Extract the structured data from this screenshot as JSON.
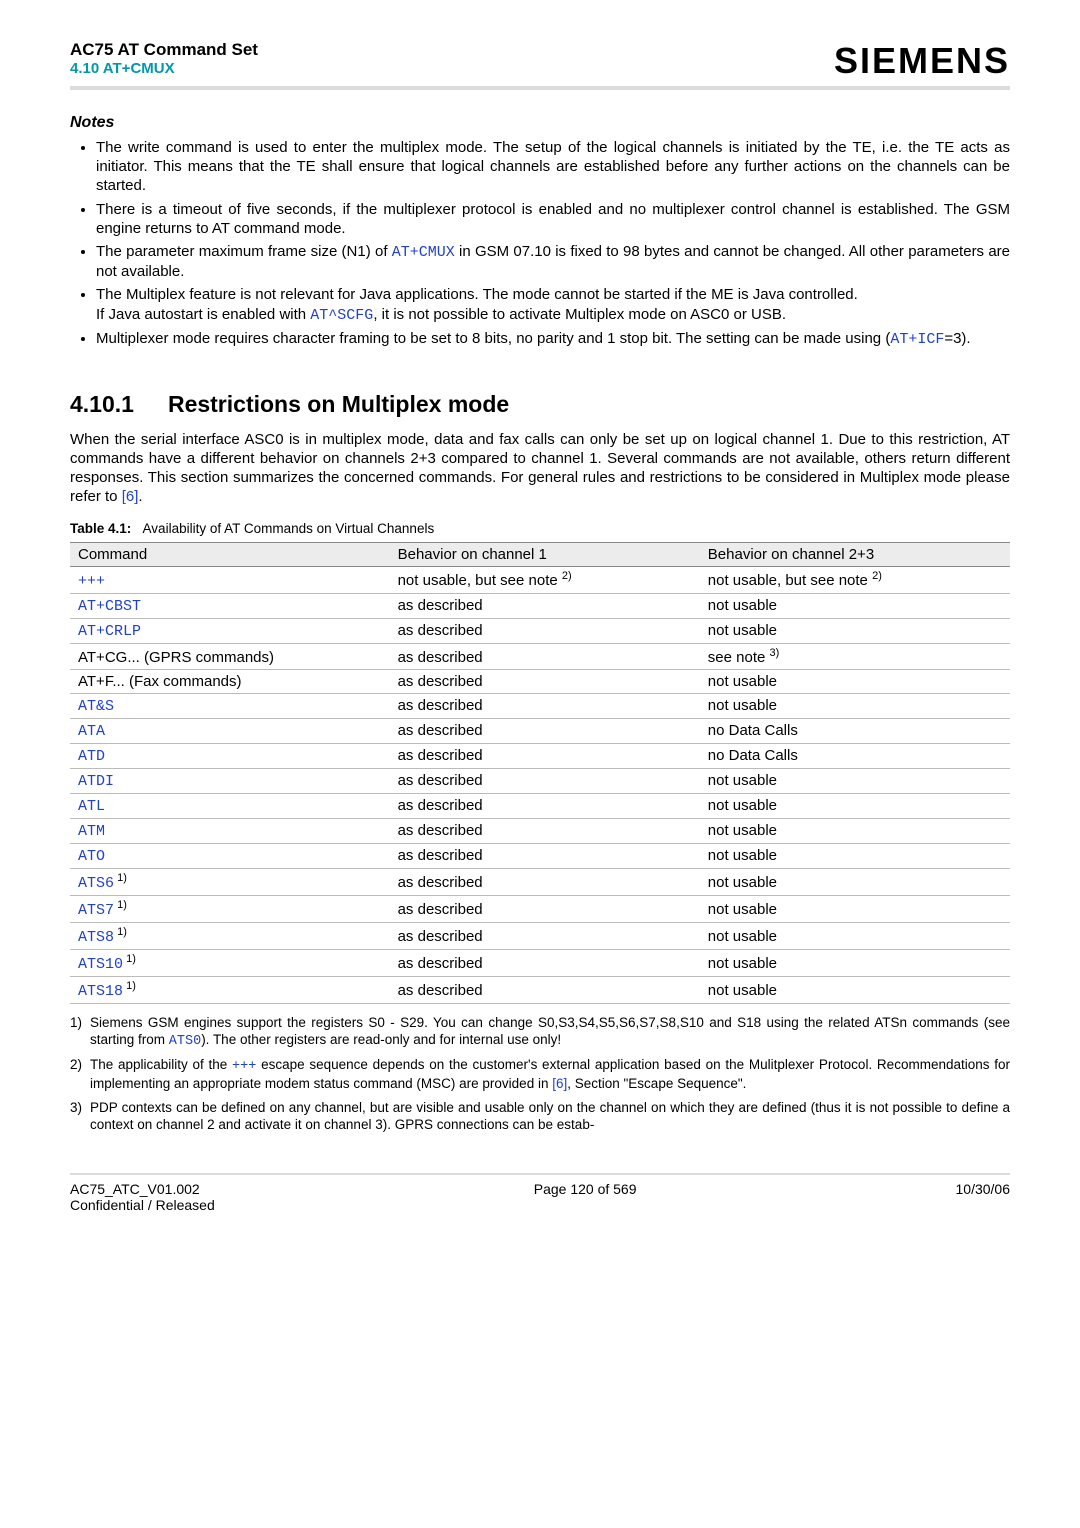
{
  "header": {
    "doc_title": "AC75 AT Command Set",
    "doc_subtitle": "4.10 AT+CMUX",
    "logo": "SIEMENS"
  },
  "notes": {
    "heading": "Notes",
    "items": [
      {
        "pre": "The write command is used to enter the multiplex mode. The setup of the logical channels is initiated by the TE, i.e. the TE acts as initiator. This means that the TE shall ensure that logical channels are established before any further actions on the channels can be started."
      },
      {
        "pre": "There is a timeout of five seconds, if the multiplexer protocol is enabled and no multiplexer control channel is established. The GSM engine returns to AT command mode."
      },
      {
        "pre": "The parameter maximum frame size (N1) of ",
        "mono1": "AT+CMUX",
        "post": " in GSM 07.10 is fixed to 98 bytes and cannot be changed. All other parameters are not available."
      },
      {
        "pre": "The Multiplex feature is not relevant for Java applications. The mode cannot be started if the ME is Java controlled.",
        "br": true,
        "pre2": "If Java autostart is enabled with ",
        "mono2": "AT^SCFG",
        "post2": ", it is not possible to activate Multiplex mode on ASC0 or USB."
      },
      {
        "pre": "Multiplexer mode requires character framing to be set to 8 bits, no parity and 1 stop bit. The setting can be made using (",
        "mono1": "AT+ICF",
        "post": "=3)."
      }
    ]
  },
  "section": {
    "num": "4.10.1",
    "title": "Restrictions on Multiplex mode",
    "body_pre": "When the serial interface ASC0 is in multiplex mode, data and fax calls can only be set up on logical channel 1. Due to this restriction, AT commands have a different behavior on channels 2+3 compared to channel 1. Several commands are not available, others return different responses. This section summarizes the concerned commands. For general rules and restrictions to be considered in Multiplex mode please refer to ",
    "body_ref": "[6]",
    "body_post": "."
  },
  "table": {
    "caption_label": "Table 4.1:",
    "caption_text": "Availability of AT Commands on Virtual Channels",
    "col1": "Command",
    "col2": "Behavior on channel 1",
    "col3": "Behavior on channel 2+3",
    "rows": [
      {
        "cmd": "+++",
        "mono": true,
        "sup": "",
        "b1_pre": "not usable, but see note ",
        "b1_sup": "2)",
        "b2_pre": "not usable, but see note ",
        "b2_sup": "2)"
      },
      {
        "cmd": "AT+CBST",
        "mono": true,
        "sup": "",
        "b1_pre": "as described",
        "b1_sup": "",
        "b2_pre": "not usable",
        "b2_sup": ""
      },
      {
        "cmd": "AT+CRLP",
        "mono": true,
        "sup": "",
        "b1_pre": "as described",
        "b1_sup": "",
        "b2_pre": "not usable",
        "b2_sup": ""
      },
      {
        "cmd": "AT+CG... (GPRS commands)",
        "mono": false,
        "sup": "",
        "b1_pre": "as described",
        "b1_sup": "",
        "b2_pre": "see note ",
        "b2_sup": "3)"
      },
      {
        "cmd": "AT+F... (Fax commands)",
        "mono": false,
        "sup": "",
        "b1_pre": "as described",
        "b1_sup": "",
        "b2_pre": "not usable",
        "b2_sup": ""
      },
      {
        "cmd": "AT&S",
        "mono": true,
        "sup": "",
        "b1_pre": "as described",
        "b1_sup": "",
        "b2_pre": "not usable",
        "b2_sup": ""
      },
      {
        "cmd": "ATA",
        "mono": true,
        "sup": "",
        "b1_pre": "as described",
        "b1_sup": "",
        "b2_pre": "no Data Calls",
        "b2_sup": ""
      },
      {
        "cmd": "ATD",
        "mono": true,
        "sup": "",
        "b1_pre": "as described",
        "b1_sup": "",
        "b2_pre": "no Data Calls",
        "b2_sup": ""
      },
      {
        "cmd": "ATDI",
        "mono": true,
        "sup": "",
        "b1_pre": "as described",
        "b1_sup": "",
        "b2_pre": "not usable",
        "b2_sup": ""
      },
      {
        "cmd": "ATL",
        "mono": true,
        "sup": "",
        "b1_pre": "as described",
        "b1_sup": "",
        "b2_pre": "not usable",
        "b2_sup": ""
      },
      {
        "cmd": "ATM",
        "mono": true,
        "sup": "",
        "b1_pre": "as described",
        "b1_sup": "",
        "b2_pre": "not usable",
        "b2_sup": ""
      },
      {
        "cmd": "ATO",
        "mono": true,
        "sup": "",
        "b1_pre": "as described",
        "b1_sup": "",
        "b2_pre": "not usable",
        "b2_sup": ""
      },
      {
        "cmd": "ATS6",
        "mono": true,
        "sup": "1)",
        "b1_pre": "as described",
        "b1_sup": "",
        "b2_pre": "not usable",
        "b2_sup": ""
      },
      {
        "cmd": "ATS7",
        "mono": true,
        "sup": "1)",
        "b1_pre": "as described",
        "b1_sup": "",
        "b2_pre": "not usable",
        "b2_sup": ""
      },
      {
        "cmd": "ATS8",
        "mono": true,
        "sup": "1)",
        "b1_pre": "as described",
        "b1_sup": "",
        "b2_pre": "not usable",
        "b2_sup": ""
      },
      {
        "cmd": "ATS10",
        "mono": true,
        "sup": "1)",
        "b1_pre": "as described",
        "b1_sup": "",
        "b2_pre": "not usable",
        "b2_sup": ""
      },
      {
        "cmd": "ATS18",
        "mono": true,
        "sup": "1)",
        "b1_pre": "as described",
        "b1_sup": "",
        "b2_pre": "not usable",
        "b2_sup": ""
      }
    ]
  },
  "footnotes": [
    {
      "num": "1)",
      "pre": "Siemens GSM engines support the registers S0 - S29. You can change S0,S3,S4,S5,S6,S7,S8,S10 and S18 using the related ATSn commands (see starting from ",
      "mono": "ATS0",
      "post": "). The other registers are read-only and for internal use only!"
    },
    {
      "num": "2)",
      "pre": "The applicability of the ",
      "mono": "+++",
      "mid": " escape sequence depends on the customer's external application based on the Mulitplexer Protocol. Recommendations for implementing an appropriate modem status command (MSC) are provided in ",
      "ref": "[6]",
      "post": ", Section \"Escape Sequence\"."
    },
    {
      "num": "3)",
      "pre": "PDP contexts can be defined on any channel, but are visible and usable only on the channel on which they are defined (thus it is not possible to define a context on channel 2 and activate it on channel 3). GPRS connections can be estab-"
    }
  ],
  "footer": {
    "left1": "AC75_ATC_V01.002",
    "left2": "Confidential / Released",
    "center": "Page 120 of 569",
    "right": "10/30/06"
  }
}
